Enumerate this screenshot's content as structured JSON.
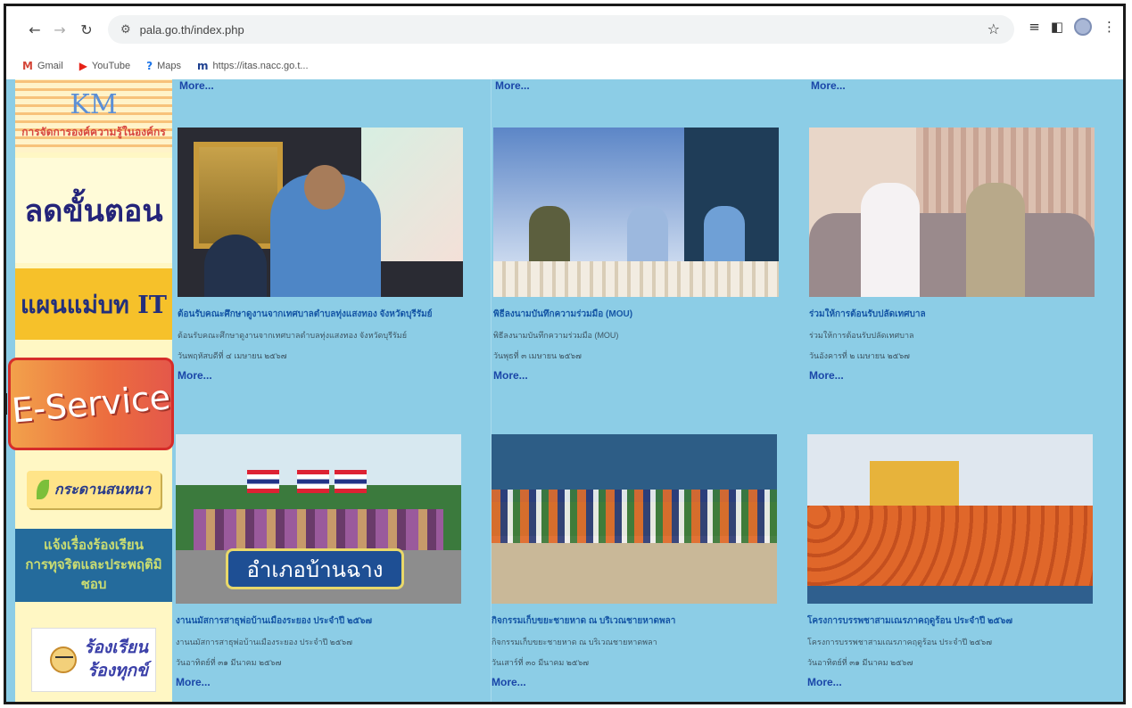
{
  "browser": {
    "url": "pala.go.th/index.php",
    "bookmarks": [
      {
        "label": "Gmail"
      },
      {
        "label": "YouTube"
      },
      {
        "label": "Maps"
      },
      {
        "label": "https://itas.nacc.go.t..."
      }
    ]
  },
  "sidebar": {
    "km_title": "KM",
    "km_subtitle": "การจัดการองค์ความรู้ในองค์กร",
    "reduce_steps": "ลดขั้นตอน",
    "it_master_plan": "แผนแม่บท IT",
    "eservice": "E-Service",
    "webboard": "กระดานสนทนา",
    "notify_line1": "แจ้งเรื่องร้องเรียน",
    "notify_line2": "การทุจริตและประพฤติมิชอบ",
    "complain_line1": "ร้องเรียน",
    "complain_line2": "ร้องทุกข์"
  },
  "top_more": [
    "More...",
    "More...",
    "More..."
  ],
  "news": [
    {
      "title": "ต้อนรับคณะศึกษาดูงานจากเทศบาลตำบลทุ่งแสงทอง จังหวัดบุรีรัมย์",
      "desc": "ต้อนรับคณะศึกษาดูงานจากเทศบาลตำบลทุ่งแสงทอง จังหวัดบุรีรัมย์",
      "date": "วันพฤหัสบดีที่ ๔ เมษายน ๒๕๖๗",
      "more": "More..."
    },
    {
      "title": "พิธีลงนามบันทึกความร่วมมือ (MOU)",
      "desc": "พิธีลงนามบันทึกความร่วมมือ (MOU)",
      "date": "วันพุธที่ ๓ เมษายน ๒๕๖๗",
      "more": "More..."
    },
    {
      "title": "ร่วมให้การต้อนรับปลัดเทศบาล",
      "desc": "ร่วมให้การต้อนรับปลัดเทศบาล",
      "date": "วันอังคารที่ ๒ เมษายน ๒๕๖๗",
      "more": "More..."
    },
    {
      "title": "งานนมัสการสาธุพ่อบ้านเมืองระยอง ประจำปี ๒๕๖๗",
      "desc": "งานนมัสการสาธุพ่อบ้านเมืองระยอง ประจำปี ๒๕๖๗",
      "date": "วันอาทิตย์ที่ ๓๑ มีนาคม ๒๕๖๗",
      "more": "More...",
      "banner": "อำเภอบ้านฉาง"
    },
    {
      "title": "กิจกรรมเก็บขยะชายหาด ณ บริเวณชายหาดพลา",
      "desc": "กิจกรรมเก็บขยะชายหาด ณ บริเวณชายหาดพลา",
      "date": "วันเสาร์ที่ ๓๐ มีนาคม ๒๕๖๗",
      "more": "More..."
    },
    {
      "title": "โครงการบรรพชาสามเณรภาคฤดูร้อน ประจำปี ๒๕๖๗",
      "desc": "โครงการบรรพชาสามเณรภาคฤดูร้อน ประจำปี ๒๕๖๗",
      "date": "วันอาทิตย์ที่ ๓๑ มีนาคม ๒๕๖๗",
      "more": "More..."
    }
  ]
}
